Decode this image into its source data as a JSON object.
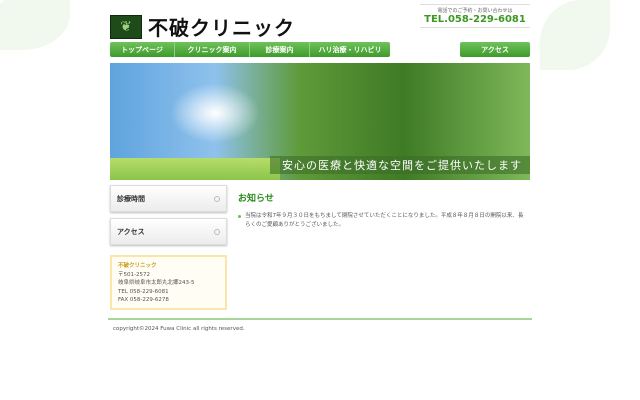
{
  "header": {
    "logo_text": "不破クリニック",
    "contact_note": "電話でのご予約・お問い合わせは",
    "tel": "TEL.058-229-6081"
  },
  "nav": {
    "items": [
      "トップページ",
      "クリニック案内",
      "診療案内",
      "ハリ治療・リハビリ"
    ],
    "access": "アクセス"
  },
  "hero": {
    "caption": "安心の医療と快適な空間をご提供いたします"
  },
  "sidebar": {
    "items": [
      "診療時間",
      "アクセス"
    ],
    "info": {
      "name": "不破クリニック",
      "postal": "〒501-2572",
      "address": "岐阜県岐阜市太郎丸北郷243-5",
      "tel": "TEL 058-229-6081",
      "fax": "FAX 058-229-6278"
    }
  },
  "main": {
    "heading": "お知らせ",
    "news": "当院は令和7年９月３０日をもちまして閉院させていただくことになりました。平成８年８月８日の開院以来、長らくのご愛顧ありがとうございました。"
  },
  "footer": {
    "copyright": "copyright©2024 Fuwa Clinic all rights reserved."
  }
}
